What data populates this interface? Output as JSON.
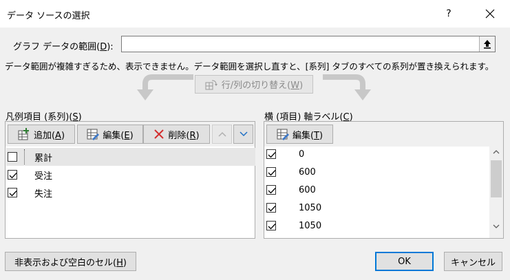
{
  "window": {
    "title": "データ ソースの選択",
    "help_label": "?"
  },
  "range": {
    "label_pre": "グラフ データの範囲(",
    "label_key": "D",
    "label_post": "):",
    "value": ""
  },
  "message": "データ範囲が複雑すぎるため、表示できません。データ範囲を選択し直すと、[系列] タブのすべての系列が置き換えられます。",
  "switch_button": {
    "pre": "行/列の切り替え(",
    "key": "W",
    "post": ")"
  },
  "legend": {
    "heading_pre": "凡例項目 (系列)(",
    "heading_key": "S",
    "heading_post": ")",
    "add_pre": "追加(",
    "add_key": "A",
    "add_post": ")",
    "edit_pre": "編集(",
    "edit_key": "E",
    "edit_post": ")",
    "delete_pre": "削除(",
    "delete_key": "R",
    "delete_post": ")",
    "items": [
      {
        "label": "累計",
        "checked": false,
        "selected": true
      },
      {
        "label": "受注",
        "checked": true,
        "selected": false
      },
      {
        "label": "失注",
        "checked": true,
        "selected": false
      }
    ]
  },
  "axis": {
    "heading_pre": "横 (項目) 軸ラベル(",
    "heading_key": "C",
    "heading_post": ")",
    "edit_pre": "編集(",
    "edit_key": "T",
    "edit_post": ")",
    "items": [
      {
        "label": "0",
        "checked": true
      },
      {
        "label": "600",
        "checked": true
      },
      {
        "label": "600",
        "checked": true
      },
      {
        "label": "1050",
        "checked": true
      },
      {
        "label": "1050",
        "checked": true
      }
    ]
  },
  "buttons": {
    "hidden_pre": "非表示および空白のセル(",
    "hidden_key": "H",
    "hidden_post": ")",
    "ok": "OK",
    "cancel": "キャンセル"
  },
  "colors": {
    "accent": "#0078d7",
    "selected_row": "#e6e6e6",
    "add_icon": "#2e7d32",
    "delete_icon": "#d32f2f",
    "arrow_disabled": "#c8c8c8"
  }
}
